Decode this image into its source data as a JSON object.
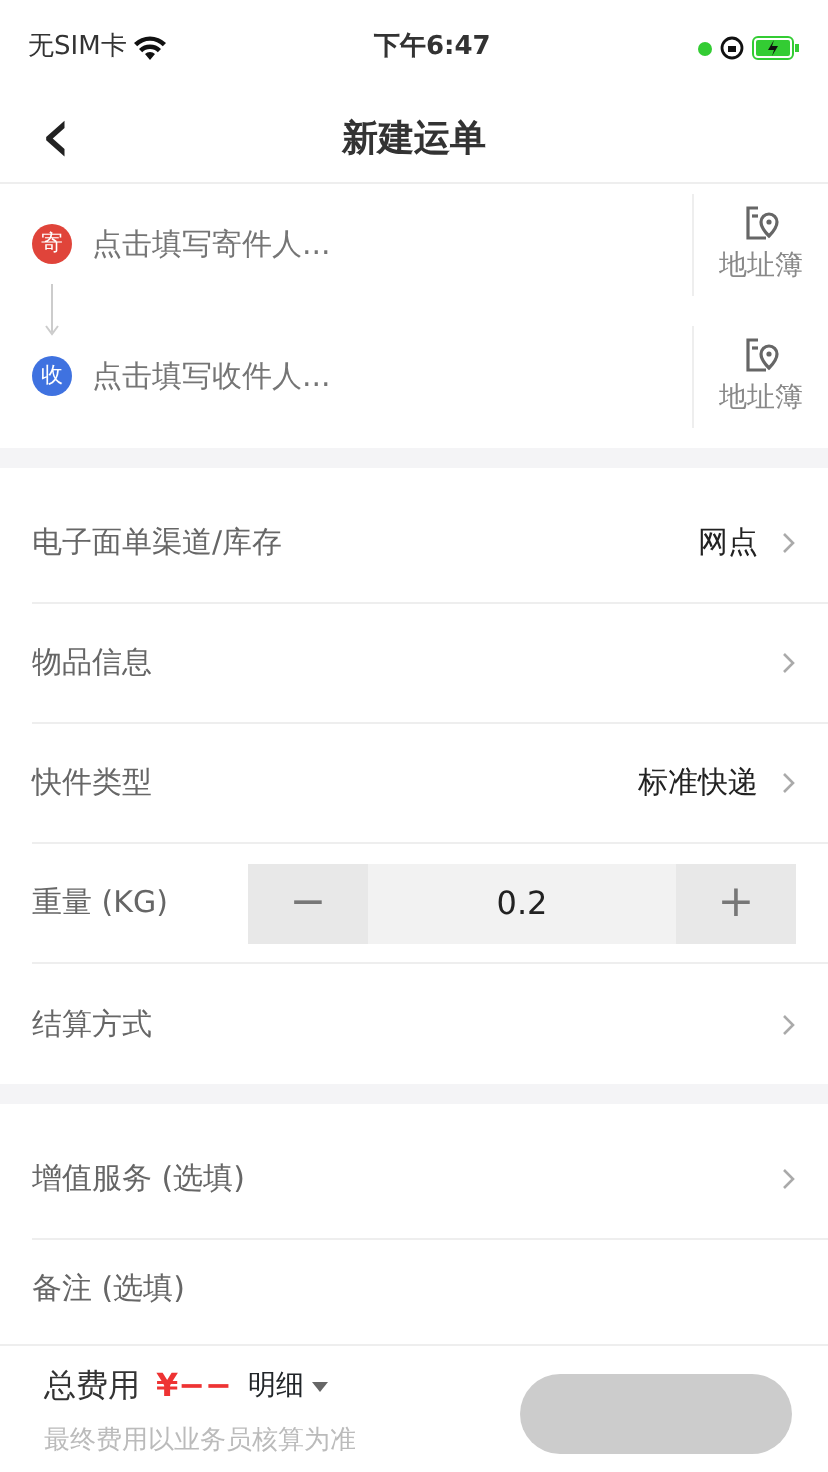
{
  "status_bar": {
    "carrier": "无SIM卡",
    "time": "下午6:47"
  },
  "nav": {
    "back": "‹",
    "title": "新建运单"
  },
  "addresses": [
    {
      "badge": "寄",
      "color": "#e0443a",
      "placeholder": "点击填写寄件人...",
      "book": "地址簿"
    },
    {
      "badge": "收",
      "color": "#3f72e0",
      "placeholder": "点击填写收件人...",
      "book": "地址簿"
    }
  ],
  "form": [
    {
      "kind": "select",
      "label": "电子面单渠道/库存",
      "value": "网点"
    },
    {
      "kind": "select",
      "label": "物品信息"
    },
    {
      "kind": "select",
      "label": "快件类型",
      "value": "标准快递"
    },
    {
      "kind": "stepper",
      "label": "重量 (KG)",
      "value": "0.2",
      "minus": "−",
      "plus": "+"
    },
    {
      "kind": "select",
      "label": "结算方式"
    }
  ],
  "extras": [
    {
      "kind": "select",
      "label": "增值服务 (选填)"
    },
    {
      "kind": "note",
      "label": "备注 (选填)"
    }
  ],
  "footer": {
    "total_label": "总费用",
    "amount": "¥−−",
    "detail": "明细",
    "note": "最终费用以业务员核算为准"
  }
}
